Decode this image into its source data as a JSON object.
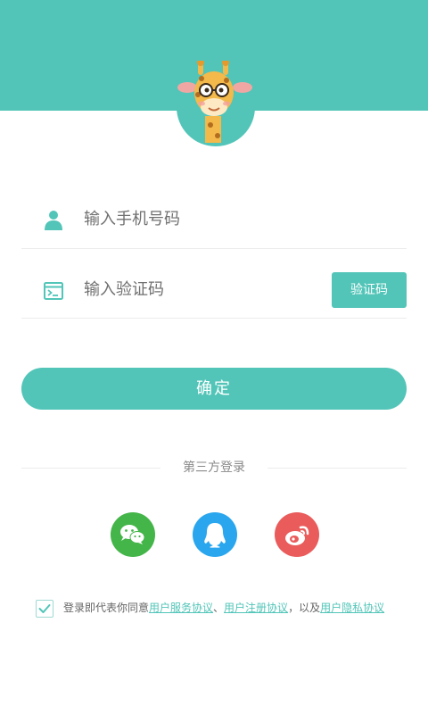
{
  "header": {
    "bg_color": "#52c5b8",
    "avatar": "giraffe-mascot"
  },
  "login": {
    "phone_placeholder": "输入手机号码",
    "code_placeholder": "输入验证码",
    "code_button": "验证码",
    "confirm_button": "确定"
  },
  "third_party": {
    "label": "第三方登录",
    "providers": [
      {
        "name": "wechat",
        "icon": "wechat-icon",
        "color": "#44b549"
      },
      {
        "name": "qq",
        "icon": "qq-icon",
        "color": "#2aa6ee"
      },
      {
        "name": "weibo",
        "icon": "weibo-icon",
        "color": "#ea5b5b"
      }
    ]
  },
  "agreement": {
    "checked": true,
    "prefix": "登录即代表你同意",
    "link_service": "用户服务协议",
    "sep1": "、",
    "link_register": "用户注册协议",
    "sep2": "，以及",
    "link_privacy": "用户隐私协议"
  },
  "colors": {
    "accent": "#52c5b8"
  }
}
